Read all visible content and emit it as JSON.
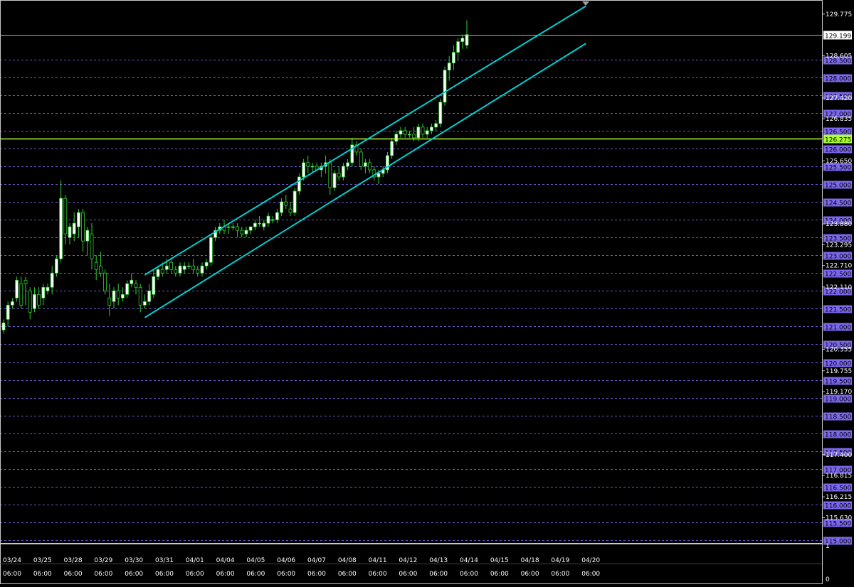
{
  "colors": {
    "background": "#000000",
    "frame": "#c8c8c8",
    "grid": "#6a5acd",
    "bull_candle": "#ffffff",
    "bear_candle": "#000000",
    "wick": "#32cd32",
    "channel": "#00ced1",
    "hline": "#adff2f",
    "bid_line": "#b0b0b0",
    "grid_label_bg": "#7b68ee",
    "grid_label_text": "#000000",
    "axis_text": "#ffffff"
  },
  "price_axis": {
    "max": 129.9,
    "min": 115.0,
    "grid_levels": [
      "128.500",
      "128.000",
      "127.500",
      "127.000",
      "126.500",
      "126.000",
      "125.500",
      "125.000",
      "124.500",
      "124.000",
      "123.500",
      "123.000",
      "122.500",
      "122.000",
      "121.500",
      "121.000",
      "120.500",
      "120.000",
      "119.500",
      "119.000",
      "118.500",
      "118.000",
      "117.500",
      "117.000",
      "116.500",
      "116.000",
      "115.500",
      "115.000"
    ],
    "scale_labels": [
      "129.775",
      "128.605",
      "127.420",
      "126.835",
      "125.650",
      "123.880",
      "123.295",
      "122.710",
      "122.110",
      "120.355",
      "119.755",
      "119.170",
      "117.400",
      "116.815",
      "116.215",
      "115.630"
    ],
    "current_price_label": "129.199",
    "current_price": 129.199,
    "hline_label": "126.275",
    "hline_price": 126.275
  },
  "time_axis": {
    "dates": [
      "03/24",
      "03/25",
      "03/28",
      "03/29",
      "03/30",
      "03/31",
      "04/01",
      "04/04",
      "04/05",
      "04/06",
      "04/07",
      "04/08",
      "04/11",
      "04/12",
      "04/13",
      "04/14",
      "04/15",
      "04/18",
      "04/19",
      "04/20"
    ],
    "times": [
      "06:00",
      "06:00",
      "06:00",
      "06:00",
      "06:00",
      "06:00",
      "06:00",
      "06:00",
      "06:00",
      "06:00",
      "06:00",
      "06:00",
      "06:00",
      "06:00",
      "06:00",
      "06:00",
      "06:00",
      "06:00",
      "06:00",
      "06:00"
    ]
  },
  "indicator_axis": {
    "top": "1",
    "bottom": "0"
  },
  "chart_data": {
    "type": "candlestick",
    "title": "",
    "ylim": [
      115.0,
      129.9
    ],
    "grid": true,
    "candles": [
      {
        "o": 120.9,
        "h": 121.2,
        "l": 120.8,
        "c": 121.1
      },
      {
        "o": 121.2,
        "h": 121.7,
        "l": 121.0,
        "c": 121.6
      },
      {
        "o": 121.6,
        "h": 121.8,
        "l": 121.5,
        "c": 121.7
      },
      {
        "o": 121.8,
        "h": 122.4,
        "l": 121.7,
        "c": 122.3
      },
      {
        "o": 122.2,
        "h": 122.4,
        "l": 121.5,
        "c": 121.6
      },
      {
        "o": 122.3,
        "h": 122.4,
        "l": 121.6,
        "c": 122.2
      },
      {
        "o": 122.0,
        "h": 122.1,
        "l": 121.2,
        "c": 121.4
      },
      {
        "o": 121.5,
        "h": 122.1,
        "l": 121.4,
        "c": 121.9
      },
      {
        "o": 121.9,
        "h": 122.1,
        "l": 121.5,
        "c": 121.6
      },
      {
        "o": 121.8,
        "h": 122.2,
        "l": 121.6,
        "c": 122.1
      },
      {
        "o": 122.0,
        "h": 122.2,
        "l": 121.9,
        "c": 122.1
      },
      {
        "o": 122.1,
        "h": 122.7,
        "l": 121.9,
        "c": 122.5
      },
      {
        "o": 122.5,
        "h": 123.0,
        "l": 122.4,
        "c": 122.9
      },
      {
        "o": 122.9,
        "h": 125.1,
        "l": 122.8,
        "c": 124.6
      },
      {
        "o": 124.6,
        "h": 124.7,
        "l": 123.3,
        "c": 123.6
      },
      {
        "o": 123.5,
        "h": 123.9,
        "l": 123.3,
        "c": 123.8
      },
      {
        "o": 123.6,
        "h": 124.2,
        "l": 123.4,
        "c": 123.9
      },
      {
        "o": 123.8,
        "h": 124.3,
        "l": 123.5,
        "c": 124.2
      },
      {
        "o": 124.2,
        "h": 124.3,
        "l": 123.1,
        "c": 123.4
      },
      {
        "o": 123.4,
        "h": 123.8,
        "l": 123.0,
        "c": 123.7
      },
      {
        "o": 123.6,
        "h": 123.9,
        "l": 122.6,
        "c": 122.9
      },
      {
        "o": 122.8,
        "h": 123.0,
        "l": 122.3,
        "c": 122.6
      },
      {
        "o": 122.7,
        "h": 123.1,
        "l": 122.4,
        "c": 122.5
      },
      {
        "o": 122.5,
        "h": 122.6,
        "l": 121.9,
        "c": 122.0
      },
      {
        "o": 121.8,
        "h": 122.2,
        "l": 121.3,
        "c": 121.6
      },
      {
        "o": 121.7,
        "h": 122.1,
        "l": 121.5,
        "c": 122.0
      },
      {
        "o": 122.0,
        "h": 122.2,
        "l": 121.6,
        "c": 121.8
      },
      {
        "o": 121.8,
        "h": 122.1,
        "l": 121.7,
        "c": 121.9
      },
      {
        "o": 121.9,
        "h": 122.3,
        "l": 121.8,
        "c": 122.2
      },
      {
        "o": 122.2,
        "h": 122.5,
        "l": 122.1,
        "c": 122.3
      },
      {
        "o": 122.2,
        "h": 122.3,
        "l": 121.9,
        "c": 122.1
      },
      {
        "o": 122.1,
        "h": 122.2,
        "l": 121.4,
        "c": 121.6
      },
      {
        "o": 121.6,
        "h": 121.9,
        "l": 121.5,
        "c": 121.7
      },
      {
        "o": 121.7,
        "h": 122.2,
        "l": 121.6,
        "c": 122.0
      },
      {
        "o": 121.9,
        "h": 122.6,
        "l": 121.8,
        "c": 122.4
      },
      {
        "o": 122.4,
        "h": 122.7,
        "l": 122.3,
        "c": 122.6
      },
      {
        "o": 122.6,
        "h": 122.8,
        "l": 122.4,
        "c": 122.5
      },
      {
        "o": 122.6,
        "h": 122.9,
        "l": 122.5,
        "c": 122.7
      },
      {
        "o": 122.8,
        "h": 122.9,
        "l": 122.5,
        "c": 122.6
      },
      {
        "o": 122.6,
        "h": 122.7,
        "l": 122.4,
        "c": 122.5
      },
      {
        "o": 122.5,
        "h": 122.8,
        "l": 122.4,
        "c": 122.7
      },
      {
        "o": 122.6,
        "h": 122.8,
        "l": 122.5,
        "c": 122.7
      },
      {
        "o": 122.7,
        "h": 122.8,
        "l": 122.6,
        "c": 122.7
      },
      {
        "o": 122.7,
        "h": 122.9,
        "l": 122.5,
        "c": 122.6
      },
      {
        "o": 122.6,
        "h": 122.7,
        "l": 122.4,
        "c": 122.5
      },
      {
        "o": 122.5,
        "h": 122.8,
        "l": 122.4,
        "c": 122.7
      },
      {
        "o": 122.7,
        "h": 122.9,
        "l": 122.6,
        "c": 122.8
      },
      {
        "o": 122.8,
        "h": 123.6,
        "l": 122.7,
        "c": 123.5
      },
      {
        "o": 123.5,
        "h": 123.8,
        "l": 123.4,
        "c": 123.7
      },
      {
        "o": 123.7,
        "h": 123.9,
        "l": 123.6,
        "c": 123.8
      },
      {
        "o": 123.8,
        "h": 124.0,
        "l": 123.6,
        "c": 123.7
      },
      {
        "o": 123.8,
        "h": 123.9,
        "l": 123.6,
        "c": 123.8
      },
      {
        "o": 123.8,
        "h": 123.9,
        "l": 123.7,
        "c": 123.8
      },
      {
        "o": 123.8,
        "h": 123.9,
        "l": 123.5,
        "c": 123.7
      },
      {
        "o": 123.7,
        "h": 123.8,
        "l": 123.5,
        "c": 123.6
      },
      {
        "o": 123.6,
        "h": 123.8,
        "l": 123.5,
        "c": 123.7
      },
      {
        "o": 123.7,
        "h": 123.8,
        "l": 123.6,
        "c": 123.8
      },
      {
        "o": 123.8,
        "h": 124.0,
        "l": 123.7,
        "c": 123.9
      },
      {
        "o": 123.9,
        "h": 124.1,
        "l": 123.8,
        "c": 123.9
      },
      {
        "o": 123.8,
        "h": 124.0,
        "l": 123.7,
        "c": 123.9
      },
      {
        "o": 123.9,
        "h": 124.2,
        "l": 123.8,
        "c": 124.1
      },
      {
        "o": 124.0,
        "h": 124.1,
        "l": 123.9,
        "c": 124.0
      },
      {
        "o": 124.0,
        "h": 124.3,
        "l": 123.9,
        "c": 124.2
      },
      {
        "o": 124.2,
        "h": 124.6,
        "l": 124.1,
        "c": 124.5
      },
      {
        "o": 124.5,
        "h": 124.7,
        "l": 124.3,
        "c": 124.4
      },
      {
        "o": 124.3,
        "h": 124.5,
        "l": 124.1,
        "c": 124.2
      },
      {
        "o": 124.2,
        "h": 124.9,
        "l": 124.1,
        "c": 124.8
      },
      {
        "o": 124.8,
        "h": 125.3,
        "l": 124.7,
        "c": 125.2
      },
      {
        "o": 125.2,
        "h": 125.7,
        "l": 125.1,
        "c": 125.6
      },
      {
        "o": 125.6,
        "h": 125.8,
        "l": 125.3,
        "c": 125.5
      },
      {
        "o": 125.5,
        "h": 125.6,
        "l": 125.3,
        "c": 125.5
      },
      {
        "o": 125.5,
        "h": 125.6,
        "l": 125.4,
        "c": 125.4
      },
      {
        "o": 125.4,
        "h": 125.6,
        "l": 125.2,
        "c": 125.5
      },
      {
        "o": 125.5,
        "h": 125.8,
        "l": 125.3,
        "c": 125.6
      },
      {
        "o": 125.6,
        "h": 125.7,
        "l": 124.7,
        "c": 124.9
      },
      {
        "o": 124.9,
        "h": 125.4,
        "l": 124.8,
        "c": 125.3
      },
      {
        "o": 125.3,
        "h": 125.5,
        "l": 125.1,
        "c": 125.2
      },
      {
        "o": 125.2,
        "h": 125.6,
        "l": 125.1,
        "c": 125.5
      },
      {
        "o": 125.5,
        "h": 125.7,
        "l": 125.4,
        "c": 125.6
      },
      {
        "o": 125.6,
        "h": 126.3,
        "l": 125.5,
        "c": 126.1
      },
      {
        "o": 126.1,
        "h": 126.2,
        "l": 125.8,
        "c": 125.9
      },
      {
        "o": 125.9,
        "h": 126.0,
        "l": 125.4,
        "c": 125.5
      },
      {
        "o": 125.5,
        "h": 125.7,
        "l": 125.3,
        "c": 125.6
      },
      {
        "o": 125.6,
        "h": 125.7,
        "l": 125.3,
        "c": 125.4
      },
      {
        "o": 125.4,
        "h": 125.5,
        "l": 125.1,
        "c": 125.2
      },
      {
        "o": 125.2,
        "h": 125.4,
        "l": 125.0,
        "c": 125.3
      },
      {
        "o": 125.3,
        "h": 125.5,
        "l": 125.2,
        "c": 125.4
      },
      {
        "o": 125.4,
        "h": 125.9,
        "l": 125.3,
        "c": 125.8
      },
      {
        "o": 125.8,
        "h": 126.3,
        "l": 125.7,
        "c": 126.2
      },
      {
        "o": 126.2,
        "h": 126.5,
        "l": 126.1,
        "c": 126.4
      },
      {
        "o": 126.4,
        "h": 126.6,
        "l": 126.3,
        "c": 126.5
      },
      {
        "o": 126.5,
        "h": 126.6,
        "l": 126.3,
        "c": 126.4
      },
      {
        "o": 126.4,
        "h": 126.5,
        "l": 126.3,
        "c": 126.4
      },
      {
        "o": 126.4,
        "h": 126.6,
        "l": 126.2,
        "c": 126.3
      },
      {
        "o": 126.3,
        "h": 126.7,
        "l": 126.2,
        "c": 126.6
      },
      {
        "o": 126.6,
        "h": 126.7,
        "l": 126.3,
        "c": 126.4
      },
      {
        "o": 126.4,
        "h": 126.6,
        "l": 126.3,
        "c": 126.5
      },
      {
        "o": 126.5,
        "h": 126.7,
        "l": 126.4,
        "c": 126.6
      },
      {
        "o": 126.6,
        "h": 126.8,
        "l": 126.5,
        "c": 126.7
      },
      {
        "o": 126.7,
        "h": 127.4,
        "l": 126.6,
        "c": 127.3
      },
      {
        "o": 127.3,
        "h": 128.3,
        "l": 127.2,
        "c": 128.2
      },
      {
        "o": 128.2,
        "h": 128.6,
        "l": 127.9,
        "c": 128.4
      },
      {
        "o": 128.4,
        "h": 128.9,
        "l": 128.2,
        "c": 128.7
      },
      {
        "o": 128.7,
        "h": 129.1,
        "l": 128.5,
        "c": 129.0
      },
      {
        "o": 129.0,
        "h": 129.2,
        "l": 128.8,
        "c": 129.1
      },
      {
        "o": 128.9,
        "h": 129.6,
        "l": 128.8,
        "c": 129.2
      }
    ],
    "channel_lines": [
      {
        "from": {
          "bar": 32,
          "price": 122.45
        },
        "to": {
          "bar": 132,
          "price": 130.0
        }
      },
      {
        "from": {
          "bar": 32,
          "price": 121.25
        },
        "to": {
          "bar": 132,
          "price": 128.95
        }
      }
    ]
  }
}
